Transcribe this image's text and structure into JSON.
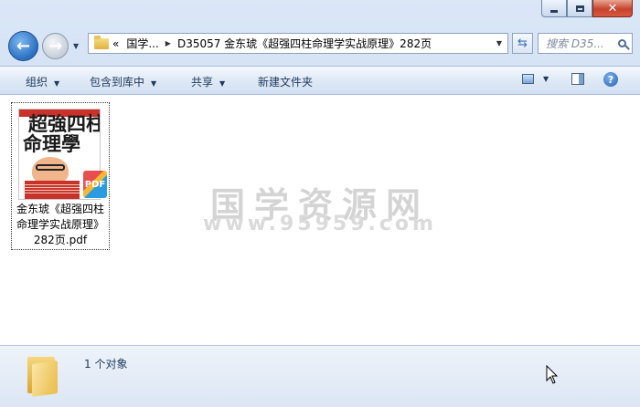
{
  "window": {
    "caption_buttons": [
      "minimize",
      "maximize",
      "close"
    ]
  },
  "nav": {
    "address_segments": [
      "国学...",
      "D35057 金东琥《超强四柱命理学实战原理》282页"
    ],
    "address_prefix": "«",
    "search_placeholder": "搜索 D35...",
    "back_glyph": "←",
    "forward_glyph": "→"
  },
  "toolbar": {
    "organize": "组织",
    "include_library": "包含到库中",
    "share": "共享",
    "new_folder": "新建文件夹",
    "help_glyph": "?"
  },
  "content": {
    "watermark_title": "国学资源网",
    "watermark_url": "www.95959.com",
    "files": [
      {
        "name": "金东琥《超强四柱命理学实战原理》282页.pdf",
        "cover_line1": "超強四柱",
        "cover_line2": "命理學",
        "badge": "PDF",
        "icon": "pdf-file-icon"
      }
    ]
  },
  "details": {
    "count_text": "1 个对象",
    "icon": "folder-icon"
  },
  "colors": {
    "accent": "#1e395b",
    "chrome": "#c6d8f0",
    "close": "#c7432c"
  }
}
